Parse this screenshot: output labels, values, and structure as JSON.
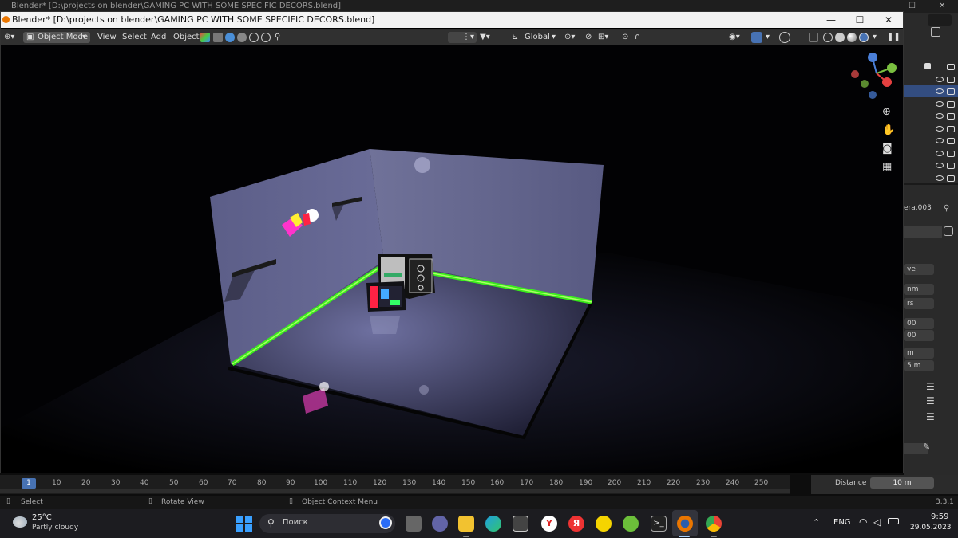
{
  "background_window": {
    "title": "Blender* [D:\\projects on blender\\GAMING PC WITH SOME SPECIFIC DECORS.blend]",
    "camera_name_partial": "era.003",
    "fields": [
      "ve",
      "nm",
      "rs",
      "00",
      "00",
      "m",
      "5 m"
    ],
    "distance_label": "Distance",
    "distance_value": "10 m",
    "version": "3.3.1"
  },
  "window": {
    "title": "Blender* [D:\\projects on blender\\GAMING PC WITH SOME SPECIFIC DECORS.blend]",
    "minimize": "—",
    "maximize": "☐",
    "close": "✕"
  },
  "header": {
    "mode": "Object Mode",
    "menu": [
      "View",
      "Select",
      "Add",
      "Object"
    ],
    "transform_orientation": "Global"
  },
  "timeline": {
    "current_frame": "1",
    "ticks": [
      "10",
      "20",
      "30",
      "40",
      "50",
      "60",
      "70",
      "80",
      "90",
      "100",
      "110",
      "120",
      "130",
      "140",
      "150",
      "160",
      "170",
      "180",
      "190",
      "200",
      "210",
      "220",
      "230",
      "240",
      "250"
    ]
  },
  "statusbar": {
    "left": "Select",
    "middle": "Rotate View",
    "right": "Object Context Menu"
  },
  "taskbar": {
    "weather_temp": "25°C",
    "weather_desc": "Partly cloudy",
    "search_placeholder": "Поиск",
    "language": "ENG",
    "time": "9:59",
    "date": "29.05.2023"
  },
  "colors": {
    "blender_orange": "#ea7600",
    "active_blue": "#4772b3",
    "neon_green": "#39ff14"
  }
}
